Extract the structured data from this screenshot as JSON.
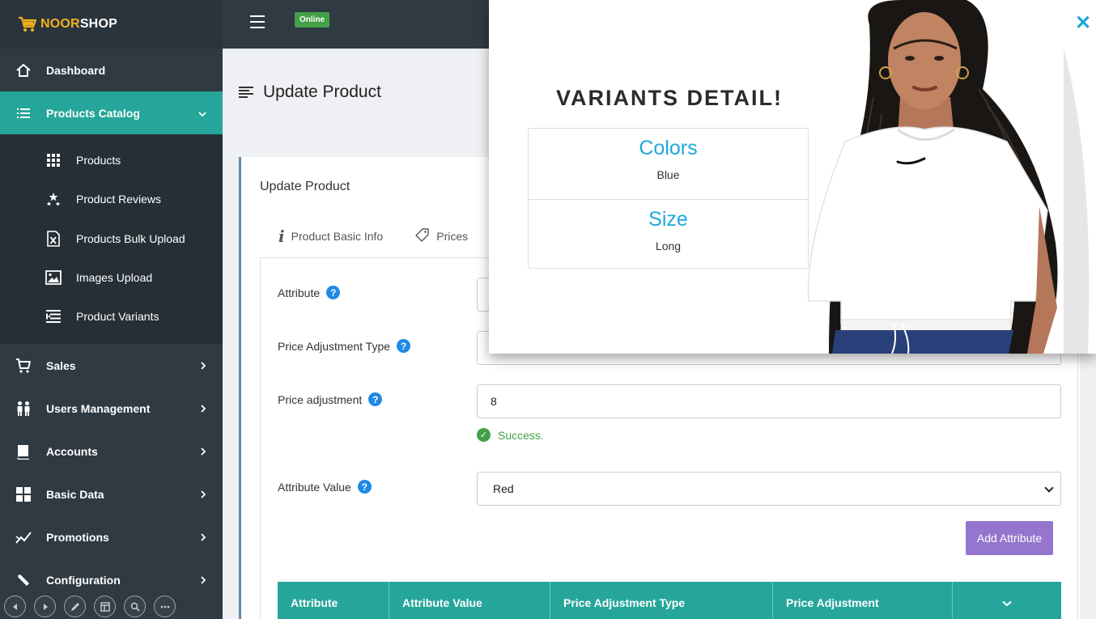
{
  "brand": {
    "noor": "NOOR",
    "shop": "SHOP"
  },
  "topbar": {
    "status_badge": "Online"
  },
  "sidebar": {
    "items": [
      {
        "label": "Dashboard",
        "icon": "home-icon"
      },
      {
        "label": "Products Catalog",
        "icon": "list-icon",
        "active": true,
        "expanded": true
      },
      {
        "label": "Sales",
        "icon": "cart-icon"
      },
      {
        "label": "Users Management",
        "icon": "users-icon"
      },
      {
        "label": "Accounts",
        "icon": "book-icon"
      },
      {
        "label": "Basic Data",
        "icon": "grid-icon"
      },
      {
        "label": "Promotions",
        "icon": "chart-line-icon"
      },
      {
        "label": "Configuration",
        "icon": "wrench-icon"
      }
    ],
    "sub_items": [
      {
        "label": "Products",
        "icon": "dots-grid-icon"
      },
      {
        "label": "Product Reviews",
        "icon": "stars-icon"
      },
      {
        "label": "Products Bulk Upload",
        "icon": "excel-file-icon"
      },
      {
        "label": "Images Upload",
        "icon": "image-icon"
      },
      {
        "label": "Product Variants",
        "icon": "variants-icon"
      }
    ]
  },
  "page": {
    "title": "Update Product"
  },
  "card": {
    "title": "Update Product",
    "tabs": [
      {
        "label": "Product Basic Info",
        "icon": "info-icon"
      },
      {
        "label": "Prices",
        "icon": "tag-icon"
      }
    ]
  },
  "form": {
    "attribute_label": "Attribute",
    "price_adjustment_type_label": "Price Adjustment Type",
    "price_adjustment_label": "Price adjustment",
    "price_adjustment_value": "8",
    "success_text": "Success.",
    "attribute_value_label": "Attribute Value",
    "attribute_value_selected": "Red",
    "add_button": "Add Attribute"
  },
  "table": {
    "headers": [
      "Attribute",
      "Attribute Value",
      "Price Adjustment Type",
      "Price Adjustment"
    ]
  },
  "modal": {
    "title": "VARIANTS DETAIL!",
    "variants": [
      {
        "name": "Colors",
        "value": "Blue"
      },
      {
        "name": "Size",
        "value": "Long"
      }
    ]
  },
  "colors": {
    "sidebar_bg": "#2f3a43",
    "accent_teal": "#26a69a",
    "button_purple": "#9575cd",
    "link_blue": "#1ea7dc",
    "success_green": "#43a047"
  }
}
